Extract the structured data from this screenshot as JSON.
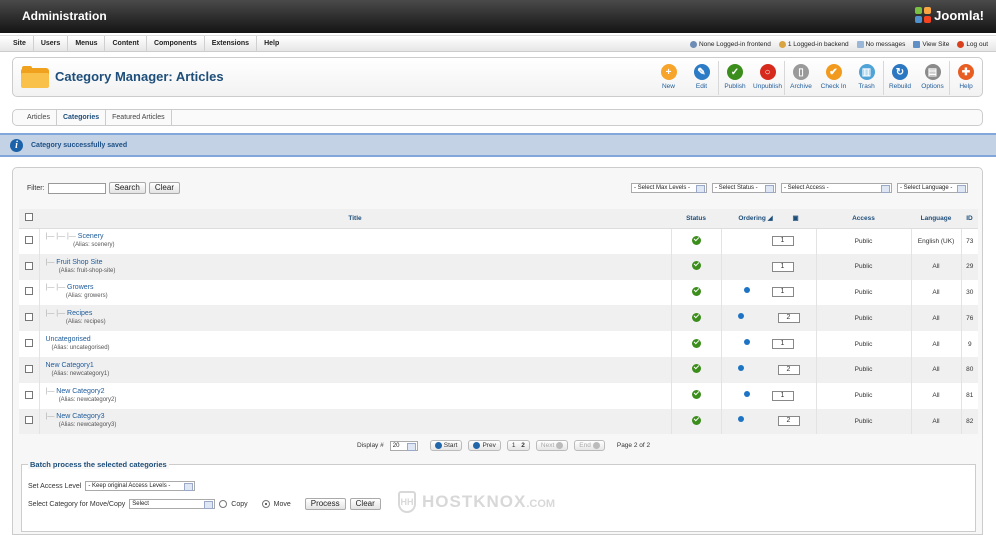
{
  "header": {
    "title": "Administration",
    "logo_text": "Joomla!"
  },
  "menu": {
    "items": [
      "Site",
      "Users",
      "Menus",
      "Content",
      "Components",
      "Extensions",
      "Help"
    ]
  },
  "status": {
    "frontend": "None Logged-in frontend",
    "backend": "1 Logged-in backend",
    "messages": "No messages",
    "view_site": "View Site",
    "logout": "Log out"
  },
  "toolbar": {
    "title": "Category Manager: Articles",
    "buttons": [
      {
        "label": "New",
        "color": "#f6a52a",
        "glyph": "+"
      },
      {
        "label": "Edit",
        "color": "#2b7bc6",
        "glyph": "✎"
      },
      {
        "label": "Publish",
        "color": "#3c8e1c",
        "glyph": "✓"
      },
      {
        "label": "Unpublish",
        "color": "#d62a1d",
        "glyph": "○"
      },
      {
        "label": "Archive",
        "color": "#9a9a9a",
        "glyph": "▯"
      },
      {
        "label": "Check In",
        "color": "#f29a1e",
        "glyph": "✔"
      },
      {
        "label": "Trash",
        "color": "#4fa3d6",
        "glyph": "▥"
      },
      {
        "label": "Rebuild",
        "color": "#2c77c1",
        "glyph": "↻"
      },
      {
        "label": "Options",
        "color": "#8a8a8a",
        "glyph": "▤"
      },
      {
        "label": "Help",
        "color": "#e85d22",
        "glyph": "✚"
      }
    ]
  },
  "submenu": {
    "tabs": [
      "Articles",
      "Categories",
      "Featured Articles"
    ],
    "active": "Categories"
  },
  "message": {
    "text": "Category successfully saved"
  },
  "filter": {
    "label": "Filter:",
    "search_label": "Search",
    "clear_label": "Clear",
    "select_max_levels": "- Select Max Levels -",
    "select_status": "- Select Status -",
    "select_access": "- Select Access -",
    "select_language": "- Select Language -"
  },
  "table": {
    "headers": {
      "title": "Title",
      "status": "Status",
      "ordering": "Ordering",
      "access": "Access",
      "language": "Language",
      "id": "ID"
    },
    "rows": [
      {
        "indent": "|— |— |— ",
        "title": "Scenery",
        "alias": "(Alias: scenery)",
        "order": "1",
        "access": "Public",
        "language": "English (UK)",
        "id": "73",
        "up": false,
        "down": false
      },
      {
        "indent": "|— ",
        "title": "Fruit Shop Site",
        "alias": "(Alias: fruit-shop-site)",
        "order": "1",
        "access": "Public",
        "language": "All",
        "id": "29",
        "up": false,
        "down": false
      },
      {
        "indent": "|— |— ",
        "title": "Growers",
        "alias": "(Alias: growers)",
        "order": "1",
        "access": "Public",
        "language": "All",
        "id": "30",
        "up": false,
        "down": true
      },
      {
        "indent": "|— |— ",
        "title": "Recipes",
        "alias": "(Alias: recipes)",
        "order": "2",
        "access": "Public",
        "language": "All",
        "id": "76",
        "up": true,
        "down": false
      },
      {
        "indent": "",
        "title": "Uncategorised",
        "alias": "(Alias: uncategorised)",
        "order": "1",
        "access": "Public",
        "language": "All",
        "id": "9",
        "up": false,
        "down": true
      },
      {
        "indent": "",
        "title": "New Category1",
        "alias": "(Alias: newcategory1)",
        "order": "2",
        "access": "Public",
        "language": "All",
        "id": "80",
        "up": true,
        "down": false
      },
      {
        "indent": "|— ",
        "title": "New Category2",
        "alias": "(Alias: newcategory2)",
        "order": "1",
        "access": "Public",
        "language": "All",
        "id": "81",
        "up": false,
        "down": true
      },
      {
        "indent": "|— ",
        "title": "New Category3",
        "alias": "(Alias: newcategory3)",
        "order": "2",
        "access": "Public",
        "language": "All",
        "id": "82",
        "up": true,
        "down": false
      }
    ]
  },
  "pagination": {
    "display_label": "Display #",
    "display_value": "20",
    "start": "Start",
    "prev": "Prev",
    "page1": "1",
    "page2": "2",
    "next": "Next",
    "end": "End",
    "page_info": "Page 2 of 2"
  },
  "batch": {
    "legend": "Batch process the selected categories",
    "access_label": "Set Access Level",
    "access_value": "- Keep original Access Levels -",
    "category_label": "Select Category for Move/Copy",
    "category_value": "Select",
    "copy_label": "Copy",
    "move_label": "Move",
    "process_label": "Process",
    "clear_label": "Clear"
  },
  "watermark": {
    "badge": "HH",
    "text": "HOSTKNOX",
    "suffix": ".COM"
  }
}
